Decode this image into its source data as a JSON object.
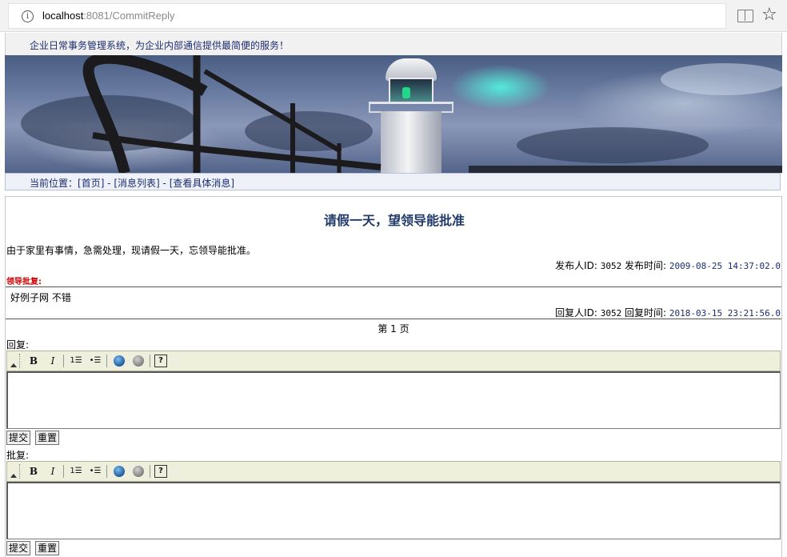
{
  "browser": {
    "url_host": "localhost",
    "url_path": ":8081/CommitReply",
    "info_icon": "i",
    "star_icon": "☆"
  },
  "header": {
    "slogan": "企业日常事务管理系统，为企业内部通信提供最简便的服务！"
  },
  "breadcrumb": {
    "prefix": "当前位置：",
    "items": [
      "[首页]",
      "[消息列表]",
      "[查看具体消息]"
    ],
    "separator": " - "
  },
  "message": {
    "title": "请假一天，望领导能批准",
    "body": "由于家里有事情，急需处理，现请假一天，忘领导能批准。",
    "publisher_label": "发布人ID:",
    "publisher_id": "3052",
    "publish_time_label": "发布时间:",
    "publish_time": "2009-08-25 14:37:02.0"
  },
  "approval": {
    "label": "领导批复:"
  },
  "reply": {
    "body": "好例子网 不错",
    "replier_label": "回复人ID:",
    "replier_id": "3052",
    "reply_time_label": "回复时间:",
    "reply_time": "2018-03-15 23:21:56.0"
  },
  "pagination": {
    "text": "第 1 页"
  },
  "reply_form": {
    "label": "回复:",
    "submit": "提交",
    "reset": "重置"
  },
  "approve_form": {
    "label": "批复:",
    "submit": "提交",
    "reset": "重置"
  },
  "toolbar": {
    "bold": "B",
    "italic": "I",
    "ordered_list": "1☰",
    "unordered_list": "•☰",
    "help": "?",
    "icons": [
      "collapse-icon",
      "bold-icon",
      "italic-icon",
      "ordered-list-icon",
      "unordered-list-icon",
      "insert-link-icon",
      "remove-link-icon",
      "help-icon"
    ]
  },
  "colors": {
    "title": "#223a6a",
    "approval_label": "#d20000",
    "toolbar_bg": "#efefde"
  }
}
